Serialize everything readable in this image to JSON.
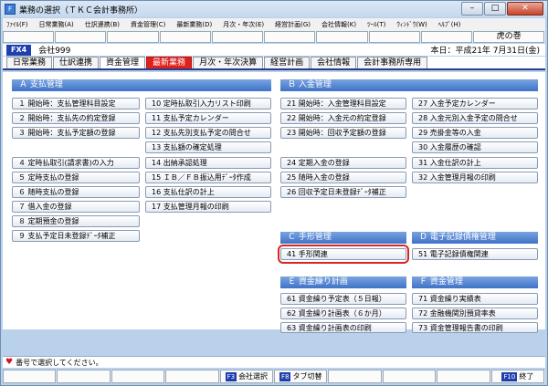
{
  "window": {
    "title": "業務の選択（ＴＫＣ会計事務所）",
    "icon_label": "F",
    "controls": {
      "minimize": "–",
      "maximize": "□",
      "close": "✕"
    }
  },
  "menubar": [
    "ﾌｧｲﾙ(F)",
    "日常業務(A)",
    "仕訳連携(B)",
    "資金管理(C)",
    "最新業務(D)",
    "月次・年次(E)",
    "経営計画(G)",
    "会社情報(K)",
    "ﾂｰﾙ(T)",
    "ｳｨﾝﾄﾞｳ(W)",
    "ﾍﾙﾌﾟ(H)"
  ],
  "top_right_button": "虎の巻",
  "info": {
    "fx": "FX4",
    "company": "会社999",
    "today": "本日：平成21年 7月31日(金)"
  },
  "tabs": [
    "日常業務",
    "仕訳連携",
    "資金管理",
    "最新業務",
    "月次・年次決算",
    "経営計画",
    "会社情報",
    "会計事務所専用"
  ],
  "sections": {
    "a": {
      "title": "Ａ 支払管理",
      "items": [
        "１ 開始時：支払管理科目設定",
        "２ 開始時：支払先の約定登録",
        "３ 開始時：支払予定額の登録",
        "４ 定時払取引(請求書)の入力",
        "５ 定時支払の登録",
        "６ 随時支払の登録",
        "７ 借入金の登録",
        "８ 定期預金の登録",
        "９ 支払予定日未登録ﾃﾞｰﾀ補正",
        "10 定時払取引入力リスト印刷",
        "11 支払予定カレンダー",
        "12 支払先別支払予定の問合せ",
        "13 支払額の確定処理",
        "14 出納承認処理",
        "15 ＩＢ／ＦＢ振込用ﾃﾞｰﾀ作成",
        "16 支払仕訳の計上",
        "17 支払管理月報の印刷"
      ]
    },
    "b": {
      "title": "Ｂ 入金管理",
      "items": [
        "21 開始時：入金管理科目設定",
        "22 開始時：入金元の約定登録",
        "23 開始時：回収予定額の登録",
        "24 定期入金の登録",
        "25 随時入金の登録",
        "26 回収予定日未登録ﾃﾞｰﾀ補正",
        "27 入金予定カレンダー",
        "28 入金元別入金予定の問合せ",
        "29 売掛金等の入金",
        "30 入金履歴の確認",
        "31 入金仕訳の計上",
        "32 入金管理月報の印刷"
      ]
    },
    "c": {
      "title": "Ｃ 手形管理",
      "items": [
        "41 手形関連"
      ]
    },
    "d": {
      "title": "Ｄ 電子記録債権管理",
      "items": [
        "51 電子記録債権関連"
      ]
    },
    "e": {
      "title": "Ｅ 資金繰り計画",
      "items": [
        "61 資金繰り予定表（５日報）",
        "62 資金繰り計画表（６か月）",
        "63 資金繰り計画表の印刷"
      ]
    },
    "f": {
      "title": "Ｆ 資金管理",
      "items": [
        "71 資金繰り実績表",
        "72 金融機関別預貸率表",
        "73 資金管理報告書の印刷"
      ]
    }
  },
  "status_text": "番号で選択してください。",
  "bottom_keys": {
    "f3": "F3",
    "f3_label": "会社選択",
    "f8": "F8",
    "f8_label": "タブ切替",
    "f10": "F10",
    "f10_label": "終了"
  },
  "colors": {
    "section_header": "#3f72c8",
    "active_red_tab": "#e0201b",
    "highlight": "#d42828",
    "fx_badge": "#1f3fae"
  }
}
